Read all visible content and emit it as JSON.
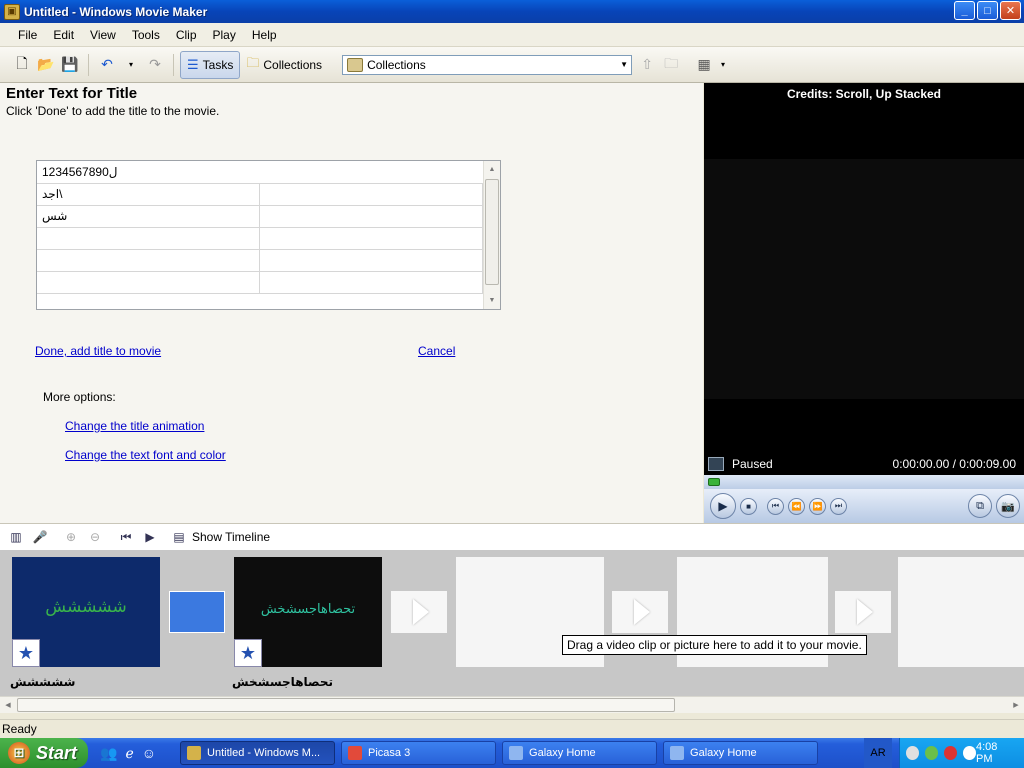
{
  "window": {
    "title": "Untitled - Windows Movie Maker",
    "buttons": {
      "minimize": "_",
      "maximize": "□",
      "close": "✕"
    }
  },
  "menu": [
    "File",
    "Edit",
    "View",
    "Tools",
    "Clip",
    "Play",
    "Help"
  ],
  "toolbar": {
    "tasks_label": "Tasks",
    "collections_label": "Collections",
    "collections_dropdown": "Collections"
  },
  "task": {
    "heading": "Enter Text for Title",
    "subheading": "Click 'Done' to add the title to the movie.",
    "grid_rows": [
      [
        "1234567890ل",
        ""
      ],
      [
        "اجد\\",
        ""
      ],
      [
        "شس",
        ""
      ],
      [
        "",
        ""
      ],
      [
        "",
        ""
      ],
      [
        "",
        ""
      ]
    ],
    "done_link": "Done, add title to movie",
    "cancel_link": "Cancel",
    "more_options": "More options:",
    "change_animation": "Change the title animation",
    "change_font": "Change the text font and color"
  },
  "monitor": {
    "title": "Credits: Scroll, Up Stacked",
    "state": "Paused",
    "time": "0:00:00.00 / 0:00:09.00",
    "progress": 0
  },
  "storyboard": {
    "show_timeline": "Show Timeline",
    "clips": [
      {
        "text": "ششششش",
        "label": "ششششش"
      },
      {
        "text": "تحصاهاجسشخش",
        "label": "تحصاهاجسشخش"
      }
    ],
    "tooltip": "Drag a video clip or picture here to add it to your movie."
  },
  "status": "Ready",
  "taskbar": {
    "start": "Start",
    "buttons": [
      "Untitled - Windows M...",
      "Picasa 3",
      "Galaxy Home",
      "Galaxy Home"
    ],
    "language": "AR",
    "clock": "4:08 PM"
  }
}
